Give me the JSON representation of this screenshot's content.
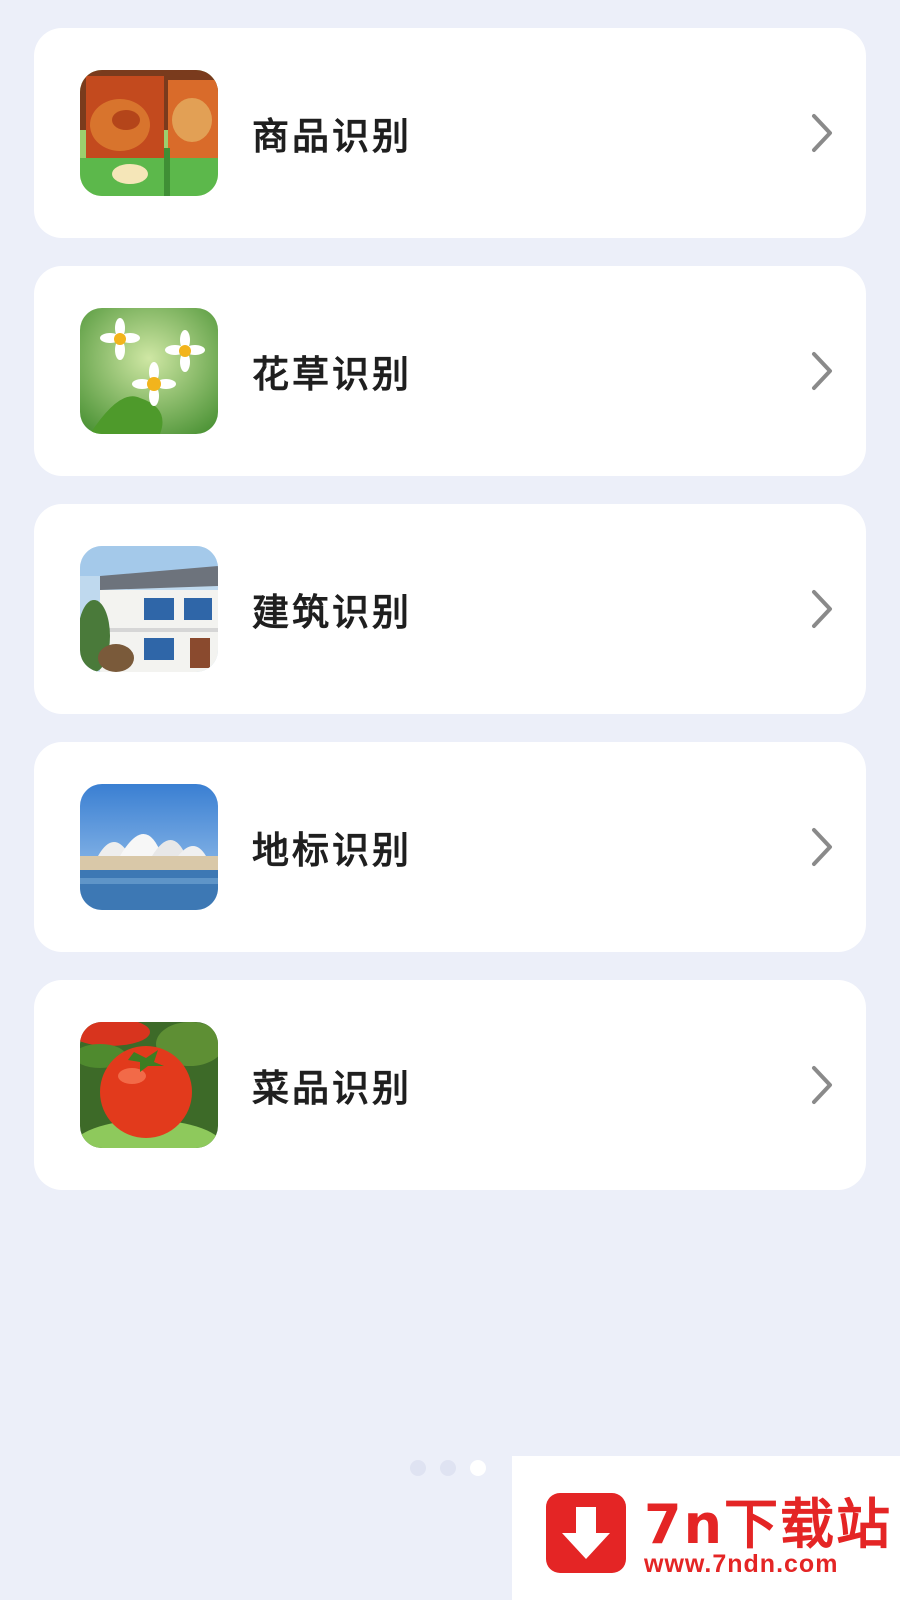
{
  "items": [
    {
      "label": "商品识别",
      "icon": "goods-product-thumbnail"
    },
    {
      "label": "花草识别",
      "icon": "flower-plant-thumbnail"
    },
    {
      "label": "建筑识别",
      "icon": "building-house-thumbnail"
    },
    {
      "label": "地标识别",
      "icon": "landmark-opera-house-thumbnail"
    },
    {
      "label": "菜品识别",
      "icon": "dish-tomato-thumbnail"
    }
  ],
  "pager": {
    "count": 3,
    "active_index": 2
  },
  "watermark": {
    "title": "7n下载站",
    "url": "www.7ndn.com"
  },
  "colors": {
    "background": "#eceff9",
    "card": "#ffffff",
    "text": "#1f1f1f",
    "chevron": "#8a8a8a",
    "watermark": "#e42525"
  }
}
